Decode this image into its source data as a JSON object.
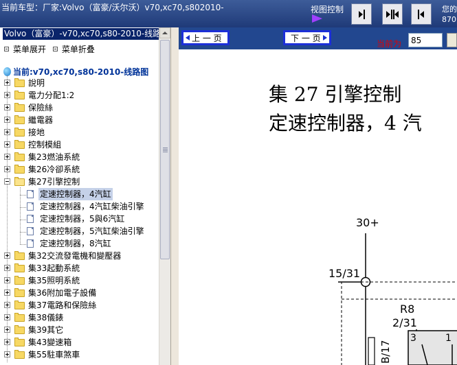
{
  "header": {
    "model_title": "当前车型：厂家:Volvo（富豪/沃尔沃）v70,xc70,s802010-",
    "view_label": "视图控制",
    "right_clip_line1": "您的",
    "right_clip_line2": "870"
  },
  "tree_panel": {
    "title": "Volvo（富豪）-v70,xc70,s80-2010-线路",
    "expand_all": "菜单展开",
    "collapse_all": "菜单折叠",
    "current": "当前:v70,xc70,s80-2010-线路图",
    "folders_top": [
      {
        "label": "說明"
      },
      {
        "label": "電力分配1:2"
      },
      {
        "label": "保險絲"
      },
      {
        "label": "繼電器"
      },
      {
        "label": "接地"
      },
      {
        "label": "控制模組"
      },
      {
        "label": "集23燃油系統"
      },
      {
        "label": "集26冷卻系統"
      }
    ],
    "open_folder": {
      "label": "集27引擎控制"
    },
    "leaves": [
      {
        "label": "定速控制器，4汽缸"
      },
      {
        "label": "定速控制器，4汽缸柴油引擎"
      },
      {
        "label": "定速控制器，5與6汽缸"
      },
      {
        "label": "定速控制器，5汽缸柴油引擎"
      },
      {
        "label": "定速控制器，8汽缸"
      }
    ],
    "folders_bottom": [
      {
        "label": "集32交流發電機和變壓器"
      },
      {
        "label": "集33起動系統"
      },
      {
        "label": "集35照明系統"
      },
      {
        "label": "集36附加電子設備"
      },
      {
        "label": "集37電路和保險絲"
      },
      {
        "label": "集38儀錶"
      },
      {
        "label": "集39其它"
      },
      {
        "label": "集43變速箱"
      },
      {
        "label": "集55駐車煞車"
      }
    ]
  },
  "toolbar": {
    "prev_label": "上 一 页",
    "next_label": "下 一 页",
    "current_page_label": "当前为",
    "current_page_value": "85"
  },
  "document": {
    "heading1": "集 27 引擎控制",
    "heading2": "定速控制器，4 汽",
    "labels": {
      "power": "30+",
      "node1": "15/31",
      "relay": "R8",
      "node2": "2/31",
      "wire": "B/17",
      "pin_left": "3",
      "pin_right": "1"
    }
  },
  "colors": {
    "header_bg": "#2a4785",
    "toolbar_bg": "#22478f",
    "selection_bg": "#0a246a",
    "page_button_border": "#1c2fd8",
    "current_label": "#e00000",
    "view_arrow": "#a040ff"
  }
}
